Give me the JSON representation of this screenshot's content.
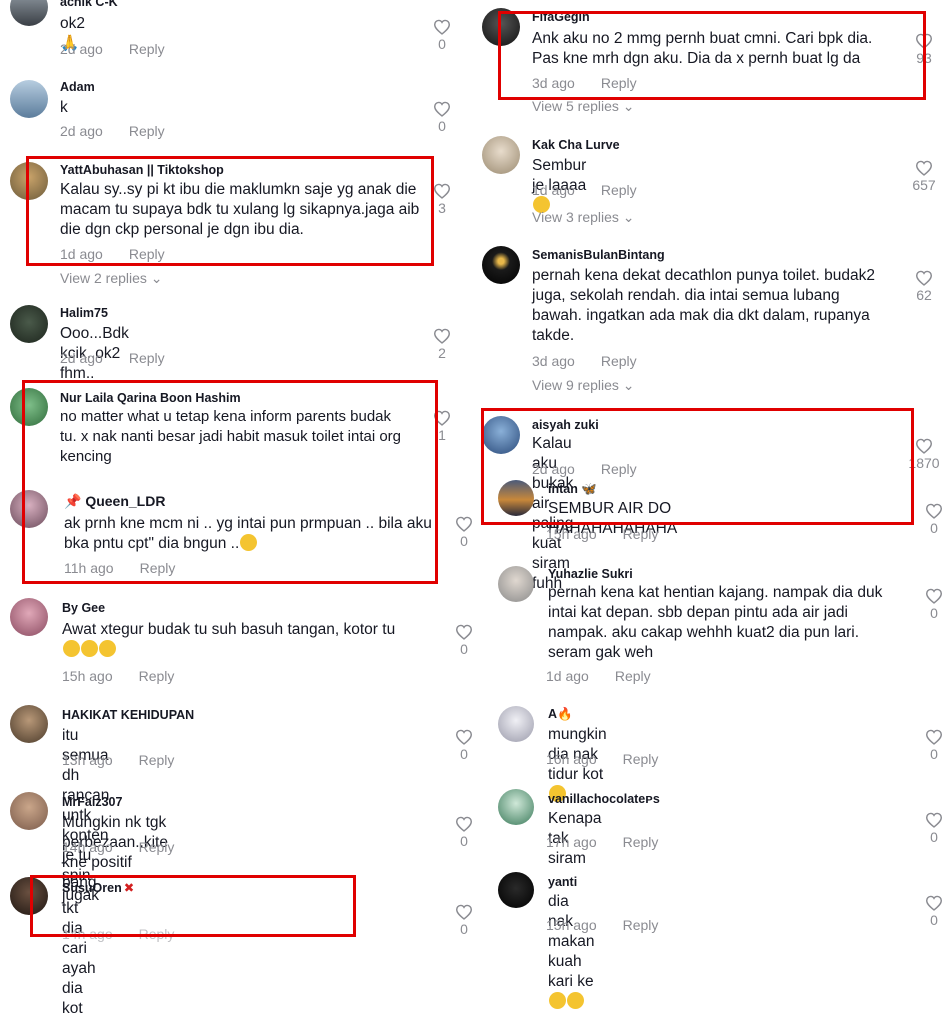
{
  "ui": {
    "reply_label": "Reply",
    "accent_red": "#e00000",
    "muted": "#8a8b91"
  },
  "left": [
    {
      "username": "achik C-K",
      "text": "ok2",
      "time": "2d ago",
      "likes": "0",
      "emoji": "🙏"
    },
    {
      "username": "Adam",
      "text": "k",
      "time": "2d ago",
      "likes": "0"
    },
    {
      "username": "YattAbuhasan || Tiktokshop",
      "text": "Kalau sy..sy pi kt ibu die maklumkn saje yg anak die macam tu supaya bdk tu xulang lg sikapnya.jaga aib die dgn ckp personal je dgn ibu dia.",
      "time": "1d ago",
      "likes": "3",
      "view_replies": "View 2 replies"
    },
    {
      "username": "Halim75",
      "text": "Ooo...Bdk kcik..ok2 fhm..",
      "time": "2d ago",
      "likes": "2"
    },
    {
      "username": "Nur Laila Qarina Boon Hashim",
      "text": "no matter what u tetap kena inform parents budak tu. x nak nanti besar jadi habit masuk toilet intai org kencing",
      "time": "",
      "likes": "1"
    },
    {
      "username": "Queen_LDR",
      "text": "ak prnh kne mcm ni .. yg intai pun prmpuan .. bila aku bka pntu cpt\" dia bngun ..",
      "time": "11h ago",
      "likes": "0"
    },
    {
      "username": "By Gee",
      "text": "Awat xtegur budak tu suh basuh tangan, kotor tu",
      "time": "15h ago",
      "likes": "0"
    },
    {
      "username": "HAKIKAT KEHIDUPAN",
      "text": "itu semua dh rancan untk konten je tu spin jugak",
      "time": "13h ago",
      "likes": "0"
    },
    {
      "username": "MrFaiz307",
      "text": "Mungkin nk tgk perbezaan..kite kne positif bang",
      "time": "14h ago",
      "likes": "0"
    },
    {
      "username": "SusuOren",
      "text": "tkt dia cari ayah dia kot",
      "time": "14h ago",
      "likes": "0"
    }
  ],
  "right": [
    {
      "username": "FifaGegin",
      "text": "Ank aku no 2 mmg pernh buat cmni. Cari bpk dia. Pas kne mrh dgn aku. Dia da x pernh buat lg da",
      "time": "3d ago",
      "likes": "93",
      "view_replies": "View 5 replies"
    },
    {
      "username": "Kak Cha Lurve",
      "text": "Sembur je laaaa",
      "time": "1d ago",
      "likes": "657",
      "view_replies": "View 3 replies"
    },
    {
      "username": "SemanisBulanBintang",
      "text": "pernah kena dekat decathlon punya toilet. budak2 juga, sekolah rendah. dia intai semua lubang bawah. ingatkan ada mak dia dkt dalam, rupanya takde.",
      "time": "3d ago",
      "likes": "62",
      "view_replies": "View 9 replies"
    },
    {
      "username": "aisyah zuki",
      "text": "Kalau aku bukak air paling kuat siram fuhh",
      "time": "2d ago",
      "likes": "1870"
    },
    {
      "username": "intan",
      "text": "SEMBUR AIR DO HAHAHAHAHAHA",
      "time": "15h ago",
      "likes": "0"
    },
    {
      "username": "Yuhazlie Sukri",
      "text": "pernah kena kat hentian kajang. nampak dia duk intai kat depan. sbb depan pintu ada air jadi nampak. aku cakap wehhh kuat2 dia pun lari. seram gak weh",
      "time": "1d ago",
      "likes": "0"
    },
    {
      "username": "A",
      "text": "mungkin dia nak tidur kot",
      "time": "16h ago",
      "likes": "0"
    },
    {
      "username": "vanillachocolateᴘs",
      "text": "Kenapa tak siram",
      "time": "17h ago",
      "likes": "0"
    },
    {
      "username": "yanti",
      "text": "dia nak makan kuah kari ke",
      "time": "15h ago",
      "likes": "0"
    }
  ]
}
